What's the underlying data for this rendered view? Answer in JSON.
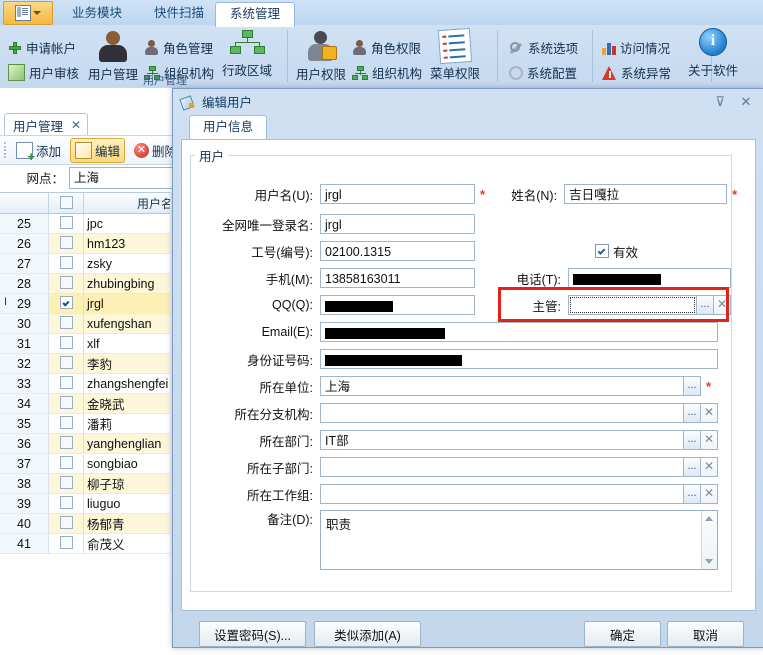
{
  "ribbon": {
    "app_button_icon": "application-menu-icon",
    "tabs": [
      {
        "label": "业务模块",
        "active": false
      },
      {
        "label": "快件扫描",
        "active": false
      },
      {
        "label": "系统管理",
        "active": true
      }
    ],
    "groups": [
      {
        "name": "用户管理",
        "items": [
          {
            "label": "申请帐户",
            "icon": "plus-icon"
          },
          {
            "label": "用户审核",
            "icon": "pencil-icon"
          },
          {
            "label": "用户管理",
            "icon": "user-icon"
          },
          {
            "label": "角色管理",
            "icon": "role-icon"
          },
          {
            "label": "组织机构",
            "icon": "org-tree-icon"
          },
          {
            "label": "行政区域",
            "icon": "region-tree-icon"
          }
        ]
      },
      {
        "name": "",
        "items": [
          {
            "label": "用户权限",
            "icon": "user-lock-icon"
          },
          {
            "label": "角色权限",
            "icon": "role-icon"
          },
          {
            "label": "组织机构",
            "icon": "org-tree-icon"
          },
          {
            "label": "菜单权限",
            "icon": "menu-check-icon"
          }
        ]
      },
      {
        "name": "",
        "items": [
          {
            "label": "系统选项",
            "icon": "wrench-icon"
          },
          {
            "label": "系统配置",
            "icon": "gear-icon"
          }
        ]
      },
      {
        "name": "",
        "items": [
          {
            "label": "访问情况",
            "icon": "bar-chart-icon"
          },
          {
            "label": "系统异常",
            "icon": "warning-icon"
          },
          {
            "label": "关于软件",
            "icon": "info-icon"
          }
        ]
      }
    ]
  },
  "document": {
    "tab_label": "用户管理",
    "tab_close": "✕",
    "toolbar": [
      {
        "label": "添加",
        "icon": "add-icon",
        "active": false
      },
      {
        "label": "编辑",
        "icon": "edit-icon",
        "active": true
      },
      {
        "label": "删除",
        "icon": "delete-icon",
        "active": false
      }
    ],
    "filter": {
      "label": "网点：",
      "value": "上海"
    },
    "grid": {
      "headers": [
        "",
        "",
        "用户名"
      ],
      "rows": [
        {
          "idx": "25",
          "checked": false,
          "name": "jpc",
          "alt": false,
          "selected": false,
          "caret": false
        },
        {
          "idx": "26",
          "checked": false,
          "name": "hm123",
          "alt": true,
          "selected": false,
          "caret": false
        },
        {
          "idx": "27",
          "checked": false,
          "name": "zsky",
          "alt": false,
          "selected": false,
          "caret": false
        },
        {
          "idx": "28",
          "checked": false,
          "name": "zhubingbing",
          "alt": true,
          "selected": false,
          "caret": false
        },
        {
          "idx": "29",
          "checked": true,
          "name": "jrgl",
          "alt": false,
          "selected": true,
          "caret": true
        },
        {
          "idx": "30",
          "checked": false,
          "name": "xufengshan",
          "alt": true,
          "selected": false,
          "caret": false
        },
        {
          "idx": "31",
          "checked": false,
          "name": "xlf",
          "alt": false,
          "selected": false,
          "caret": false
        },
        {
          "idx": "32",
          "checked": false,
          "name": "李豹",
          "alt": true,
          "selected": false,
          "caret": false
        },
        {
          "idx": "33",
          "checked": false,
          "name": "zhangshengfei",
          "alt": false,
          "selected": false,
          "caret": false
        },
        {
          "idx": "34",
          "checked": false,
          "name": "金晓武",
          "alt": true,
          "selected": false,
          "caret": false
        },
        {
          "idx": "35",
          "checked": false,
          "name": "潘莉",
          "alt": false,
          "selected": false,
          "caret": false
        },
        {
          "idx": "36",
          "checked": false,
          "name": "yanghenglian",
          "alt": true,
          "selected": false,
          "caret": false
        },
        {
          "idx": "37",
          "checked": false,
          "name": "songbiao",
          "alt": false,
          "selected": false,
          "caret": false
        },
        {
          "idx": "38",
          "checked": false,
          "name": "柳子琼",
          "alt": true,
          "selected": false,
          "caret": false
        },
        {
          "idx": "39",
          "checked": false,
          "name": "liuguo",
          "alt": false,
          "selected": false,
          "caret": false
        },
        {
          "idx": "40",
          "checked": false,
          "name": "杨郁青",
          "alt": true,
          "selected": false,
          "caret": false
        },
        {
          "idx": "41",
          "checked": false,
          "name": "俞茂义",
          "alt": false,
          "selected": false,
          "caret": false
        }
      ]
    }
  },
  "dialog": {
    "title": "编辑用户",
    "title_icon": "edit-user-icon",
    "pin_icon": "pin-icon",
    "close_icon": "close-icon",
    "tab_label": "用户信息",
    "group_legend": "用户",
    "fields": {
      "username": {
        "label": "用户名(U):",
        "value": "jrgl",
        "required": true
      },
      "fullname": {
        "label": "姓名(N):",
        "value": "吉日嘎拉",
        "required": true
      },
      "global_login": {
        "label": "全网唯一登录名:",
        "value": "jrgl",
        "required": false
      },
      "employee_no": {
        "label": "工号(编号):",
        "value": "02100.1315",
        "required": false
      },
      "valid": {
        "label": "有效",
        "checked": true
      },
      "mobile": {
        "label": "手机(M):",
        "value": "13858163011",
        "required": false
      },
      "phone": {
        "label": "电话(T):",
        "value": "",
        "redacted": true,
        "redact_width": 88
      },
      "qq": {
        "label": "QQ(Q):",
        "value": "",
        "redacted": true,
        "redact_width": 68
      },
      "supervisor": {
        "label": "主管:",
        "value": "",
        "focused": true,
        "highlighted": true
      },
      "email": {
        "label": "Email(E):",
        "value": "",
        "redacted": true,
        "redact_width": 120
      },
      "id_card": {
        "label": "身份证号码:",
        "value": "",
        "redacted": true,
        "redact_width": 137
      },
      "unit": {
        "label": "所在单位:",
        "value": "上海",
        "required": true
      },
      "branch": {
        "label": "所在分支机构:",
        "value": ""
      },
      "department": {
        "label": "所在部门:",
        "value": "IT部"
      },
      "sub_department": {
        "label": "所在子部门:",
        "value": ""
      },
      "workgroup": {
        "label": "所在工作组:",
        "value": ""
      },
      "remark": {
        "label": "备注(D):",
        "value": "职责"
      }
    },
    "buttons": {
      "set_password": "设置密码(S)...",
      "similar_add": "类似添加(A)",
      "ok": "确定",
      "cancel": "取消"
    },
    "ellipsis_label": "...",
    "clear_label": "✕"
  },
  "colors": {
    "accent_highlight": "#e2231a",
    "ribbon_bg": "#cfe0f3",
    "selected_row": "#fdf0b5",
    "alt_row": "#fdf6d8",
    "app_button": "#f6b93f"
  }
}
